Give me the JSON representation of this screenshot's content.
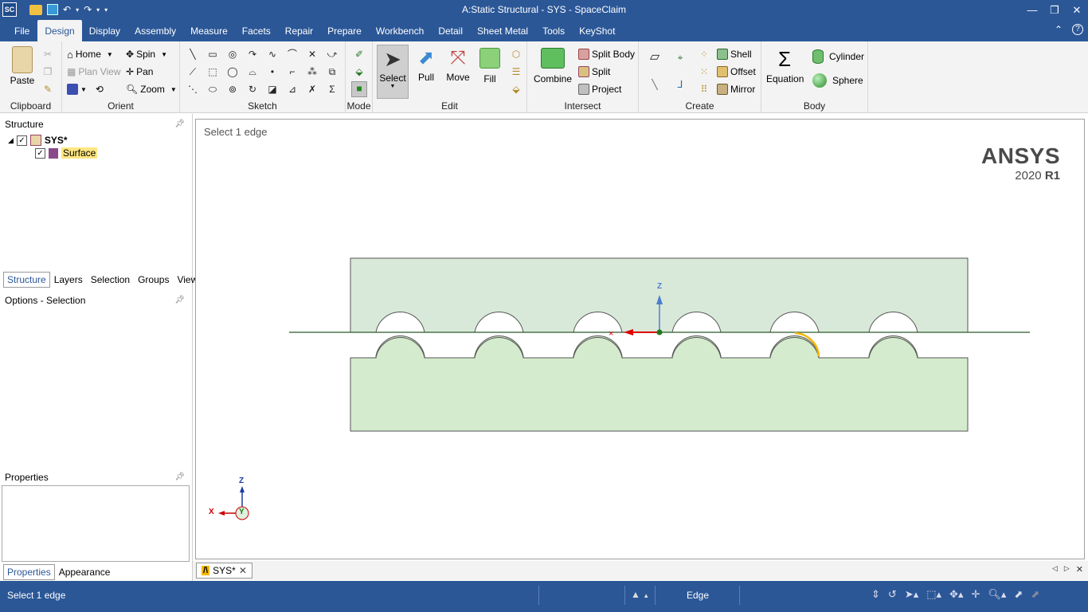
{
  "window": {
    "title": "A:Static Structural - SYS - SpaceClaim"
  },
  "menu": {
    "tabs": [
      "File",
      "Design",
      "Display",
      "Assembly",
      "Measure",
      "Facets",
      "Repair",
      "Prepare",
      "Workbench",
      "Detail",
      "Sheet Metal",
      "Tools",
      "KeyShot"
    ],
    "active": "Design"
  },
  "ribbon": {
    "clipboard": {
      "label": "Clipboard",
      "paste": "Paste"
    },
    "orient": {
      "label": "Orient",
      "home": "Home",
      "plan_view": "Plan View",
      "spin": "Spin",
      "pan": "Pan",
      "zoom": "Zoom"
    },
    "sketch": {
      "label": "Sketch"
    },
    "mode": {
      "label": "Mode"
    },
    "edit": {
      "label": "Edit",
      "select": "Select",
      "pull": "Pull",
      "move": "Move",
      "fill": "Fill"
    },
    "intersect": {
      "label": "Intersect",
      "combine": "Combine",
      "split_body": "Split Body",
      "split": "Split",
      "project": "Project"
    },
    "create": {
      "label": "Create",
      "shell": "Shell",
      "offset": "Offset",
      "mirror": "Mirror"
    },
    "body": {
      "label": "Body",
      "equation": "Equation",
      "cylinder": "Cylinder",
      "sphere": "Sphere"
    }
  },
  "structure": {
    "title": "Structure",
    "root": "SYS*",
    "child": "Surface",
    "tabs": [
      "Structure",
      "Layers",
      "Selection",
      "Groups",
      "Views"
    ],
    "active_tab": "Structure"
  },
  "options": {
    "title": "Options - Selection"
  },
  "properties": {
    "title": "Properties",
    "tabs": [
      "Properties",
      "Appearance"
    ],
    "active_tab": "Properties"
  },
  "viewport": {
    "hint": "Select 1 edge",
    "brand": "ANSYS",
    "version": "2020",
    "release": "R1",
    "triad": {
      "z": "Z",
      "x": "X",
      "y": "Y"
    }
  },
  "doc_tab": {
    "label": "SYS*"
  },
  "status": {
    "text": "Select 1 edge",
    "mode": "Edge"
  },
  "colors": {
    "accent": "#2b5797",
    "top_body": "#d9e9d9",
    "bottom_body": "#d4ebcd",
    "highlight": "#f5b800"
  }
}
